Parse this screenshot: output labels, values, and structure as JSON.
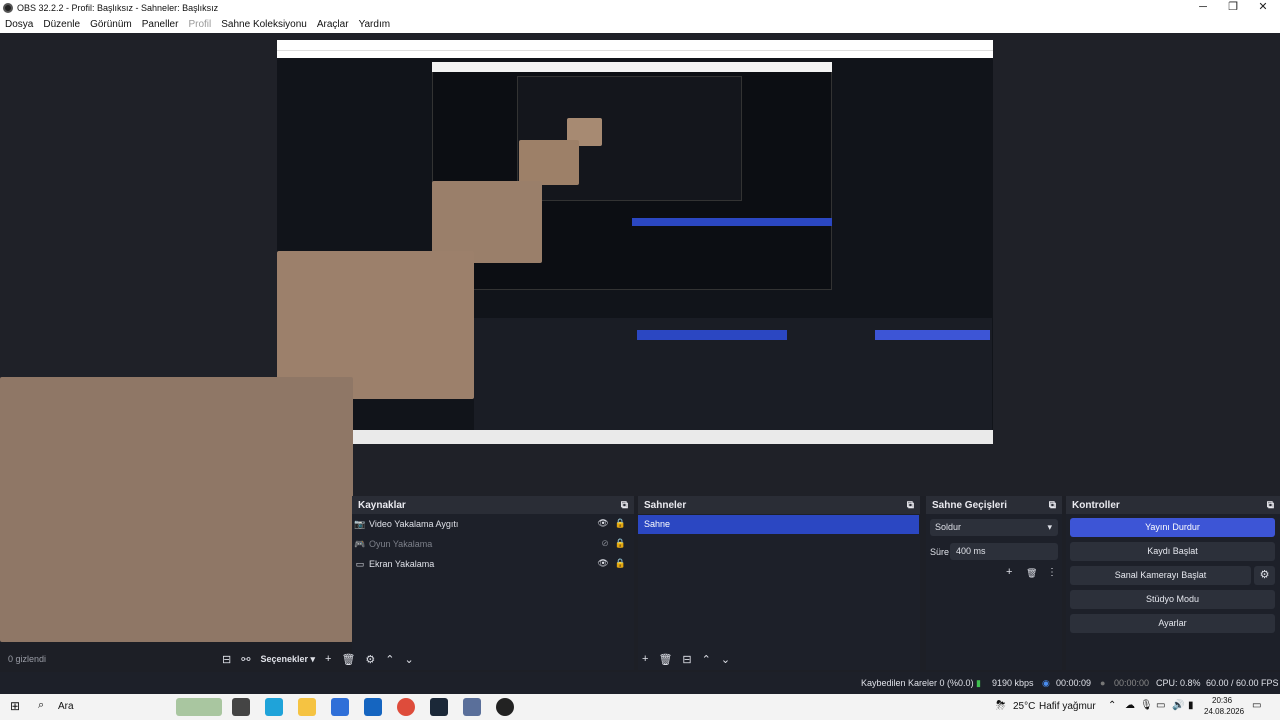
{
  "window": {
    "title": "OBS 32.2.2 - Profil: Başlıksız - Sahneler: Başlıksız",
    "min": "─",
    "max": "❐",
    "close": "✕"
  },
  "menu": [
    "Dosya",
    "Düzenle",
    "Görünüm",
    "Paneller",
    "Profil",
    "Sahne Koleksiyonu",
    "Araçlar",
    "Yardım"
  ],
  "sources": {
    "title": "Kaynaklar",
    "items": [
      {
        "name": "Video Yakalama Aygıtı",
        "icon": "camera-icon",
        "visible": true
      },
      {
        "name": "Oyun Yakalama",
        "icon": "gamepad-icon",
        "visible": false
      },
      {
        "name": "Ekran Yakalama",
        "icon": "monitor-icon",
        "visible": true
      }
    ],
    "hidden_count": "0 gizlendi",
    "options": "Seçenekler"
  },
  "scenes": {
    "title": "Sahneler",
    "items": [
      "Sahne"
    ]
  },
  "transitions": {
    "title": "Sahne Geçişleri",
    "selected": "Soldur",
    "duration_label": "Süre",
    "duration": "400 ms"
  },
  "controls": {
    "title": "Kontroller",
    "stop_stream": "Yayını Durdur",
    "start_record": "Kaydı Başlat",
    "start_vcam": "Sanal Kamerayı Başlat",
    "studio": "Stüdyo Modu",
    "settings": "Ayarlar"
  },
  "status": {
    "dropped": "Kaybedilen Kareler 0 (%0.0)",
    "bitrate": "9190 kbps",
    "stream_time": "00:00:09",
    "rec_time": "00:00:00",
    "cpu": "CPU: 0.8%",
    "fps": "60.00 / 60.00 FPS"
  },
  "taskbar": {
    "search": "Ara",
    "weather_temp": "25°C",
    "weather_text": "Hafif yağmur",
    "time": "20:36",
    "date": "24.08.2026"
  },
  "colors": {
    "accent": "#3d55d6",
    "scene_selected": "#2b47c2",
    "panel_bg": "#1d2029"
  }
}
